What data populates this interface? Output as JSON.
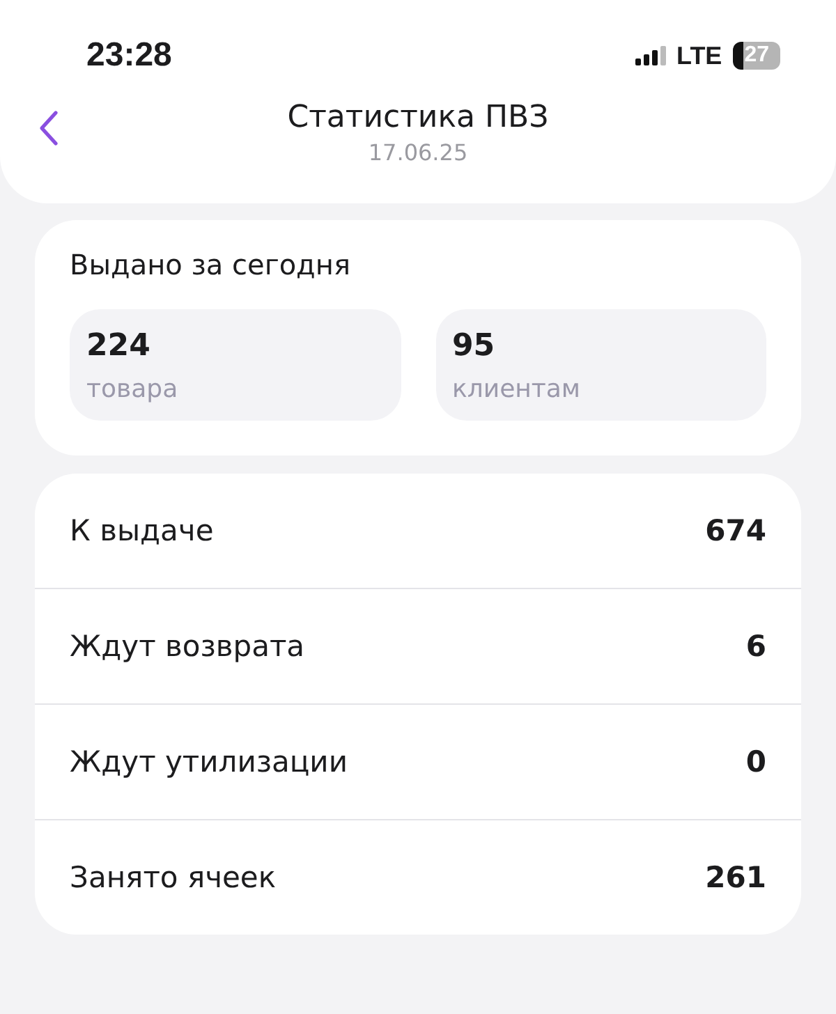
{
  "status_bar": {
    "time": "23:28",
    "network": "LTE",
    "battery": "27"
  },
  "header": {
    "title": "Статистика ПВЗ",
    "subtitle": "17.06.25"
  },
  "issued_today": {
    "title": "Выдано за сегодня",
    "tiles": [
      {
        "value": "224",
        "label": "товара"
      },
      {
        "value": "95",
        "label": "клиентам"
      }
    ]
  },
  "stats": [
    {
      "label": "К выдаче",
      "value": "674"
    },
    {
      "label": "Ждут возврата",
      "value": "6"
    },
    {
      "label": "Ждут утилизации",
      "value": "0"
    },
    {
      "label": "Занято ячеек",
      "value": "261"
    }
  ]
}
